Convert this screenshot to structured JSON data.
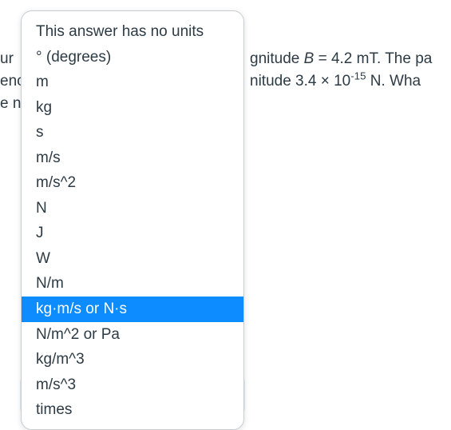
{
  "background": {
    "line1_left": "ur",
    "line2_left": "enc",
    "line3_left": "e n",
    "line1_right_pre": "gnitude ",
    "line1_right_var": "B",
    "line1_right_post": " = 4.2 mT. The pa",
    "line2_right_pre": "nitude 3.4 × 10",
    "line2_right_exp": "-15",
    "line2_right_post": " N. Wha"
  },
  "dropdown": {
    "items": [
      "This answer has no units",
      "° (degrees)",
      "m",
      "kg",
      "s",
      "m/s",
      "m/s^2",
      "N",
      "J",
      "W",
      "N/m",
      "kg·m/s or N·s",
      "N/m^2 or Pa",
      "kg/m^3",
      "m/s^3",
      "times"
    ],
    "selectedIndex": 11
  },
  "select": {
    "value": ""
  }
}
